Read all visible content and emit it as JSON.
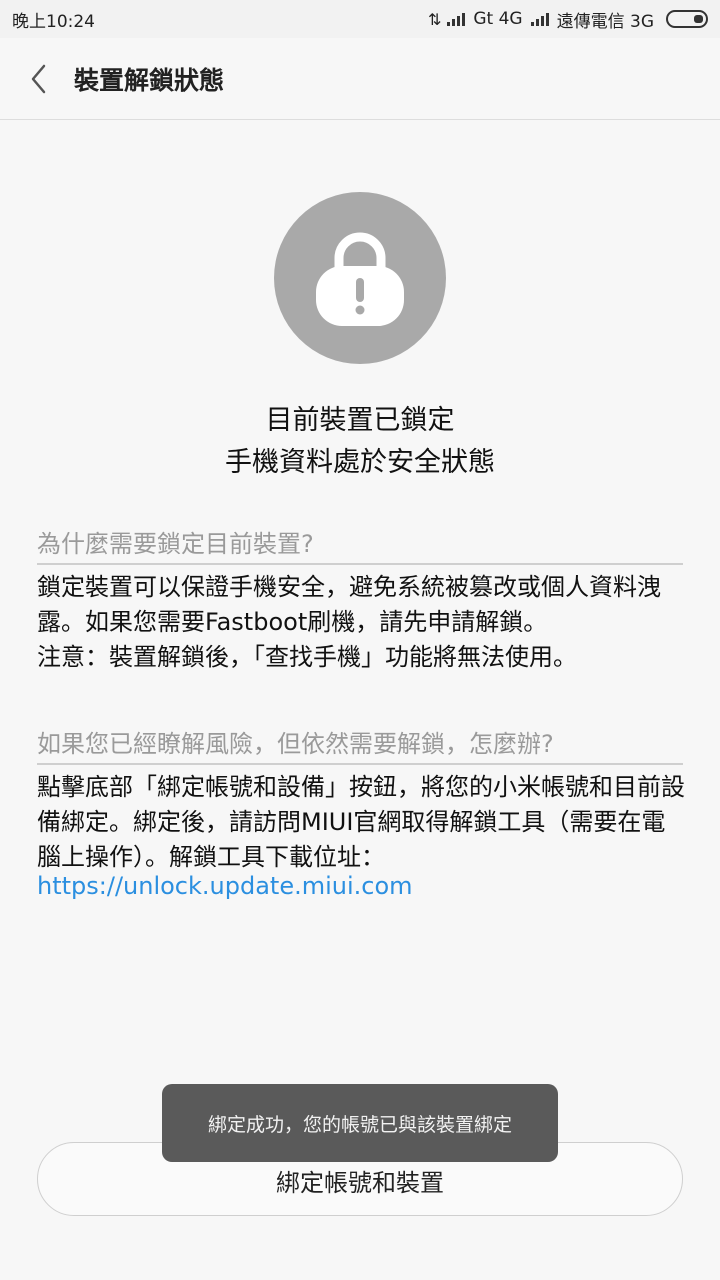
{
  "status_bar": {
    "time": "晚上10:24",
    "carrier1": "Gt 4G",
    "carrier2": "遠傳電信 3G"
  },
  "header": {
    "title": "裝置解鎖狀態"
  },
  "lock": {
    "icon": "lock-icon"
  },
  "status": {
    "line1": "目前裝置已鎖定",
    "line2": "手機資料處於安全狀態"
  },
  "section1": {
    "question": "為什麼需要鎖定目前裝置?",
    "body": "鎖定裝置可以保證手機安全，避免系統被篡改或個人資料洩露。如果您需要Fastboot刷機，請先申請解鎖。",
    "note": "注意：裝置解鎖後，「查找手機」功能將無法使用。"
  },
  "section2": {
    "question": "如果您已經瞭解風險，但依然需要解鎖，怎麼辦?",
    "body": "點擊底部「綁定帳號和設備」按鈕，將您的小米帳號和目前設備綁定。綁定後，請訪問MIUI官網取得解鎖工具（需要在電腦上操作）。解鎖工具下載位址：",
    "link": "https://unlock.update.miui.com"
  },
  "toast": {
    "text": "綁定成功，您的帳號已與該裝置綁定"
  },
  "bind_button": {
    "label": "綁定帳號和裝置"
  },
  "colors": {
    "link": "#2b8fe0",
    "lock_circle": "#a9a9a9",
    "toast_bg": "#5a5a5a"
  }
}
